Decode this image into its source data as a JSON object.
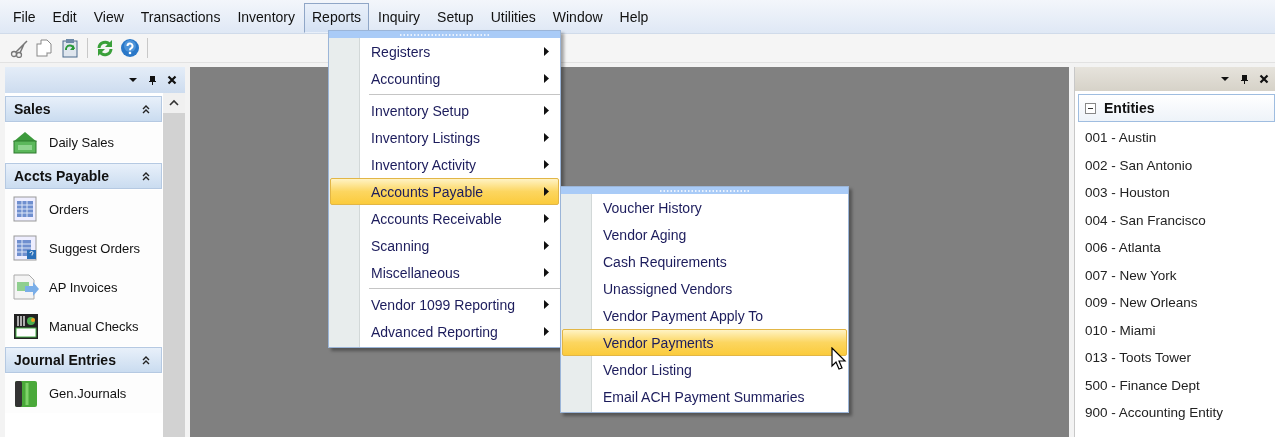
{
  "menubar": {
    "items": [
      {
        "label": "File",
        "selected": false
      },
      {
        "label": "Edit",
        "selected": false
      },
      {
        "label": "View",
        "selected": false
      },
      {
        "label": "Transactions",
        "selected": false
      },
      {
        "label": "Inventory",
        "selected": false
      },
      {
        "label": "Reports",
        "selected": true
      },
      {
        "label": "Inquiry",
        "selected": false
      },
      {
        "label": "Setup",
        "selected": false
      },
      {
        "label": "Utilities",
        "selected": false
      },
      {
        "label": "Window",
        "selected": false
      },
      {
        "label": "Help",
        "selected": false
      }
    ]
  },
  "nav_panel": {
    "groups": [
      {
        "title": "Sales",
        "expanded": true,
        "items": [
          {
            "label": "Daily Sales",
            "kind": "money"
          }
        ]
      },
      {
        "title": "Accts Payable",
        "expanded": true,
        "items": [
          {
            "label": "Orders",
            "kind": "grid"
          },
          {
            "label": "Suggest Orders",
            "kind": "grid-help"
          },
          {
            "label": "AP Invoices",
            "kind": "invoice"
          },
          {
            "label": "Manual Checks",
            "kind": "check"
          }
        ]
      },
      {
        "title": "Journal Entries",
        "expanded": true,
        "items": [
          {
            "label": "Gen.Journals",
            "kind": "book"
          }
        ]
      }
    ]
  },
  "reports_menu": {
    "sections": [
      [
        {
          "label": "Registers",
          "submenu": true,
          "selected": false
        },
        {
          "label": "Accounting",
          "submenu": true,
          "selected": false
        }
      ],
      [
        {
          "label": "Inventory Setup",
          "submenu": true,
          "selected": false
        },
        {
          "label": "Inventory Listings",
          "submenu": true,
          "selected": false
        },
        {
          "label": "Inventory Activity",
          "submenu": true,
          "selected": false
        },
        {
          "label": "Accounts Payable",
          "submenu": true,
          "selected": true
        },
        {
          "label": "Accounts Receivable",
          "submenu": true,
          "selected": false
        },
        {
          "label": "Scanning",
          "submenu": true,
          "selected": false
        },
        {
          "label": "Miscellaneous",
          "submenu": true,
          "selected": false
        }
      ],
      [
        {
          "label": "Vendor 1099 Reporting",
          "submenu": true,
          "selected": false
        },
        {
          "label": "Advanced Reporting",
          "submenu": true,
          "selected": false
        }
      ]
    ]
  },
  "accounts_payable_menu": {
    "sections": [
      [
        {
          "label": "Voucher History",
          "submenu": false,
          "selected": false
        },
        {
          "label": "Vendor Aging",
          "submenu": false,
          "selected": false
        },
        {
          "label": "Cash Requirements",
          "submenu": false,
          "selected": false
        },
        {
          "label": "Unassigned Vendors",
          "submenu": false,
          "selected": false
        },
        {
          "label": "Vendor Payment Apply To",
          "submenu": false,
          "selected": false
        },
        {
          "label": "Vendor Payments",
          "submenu": false,
          "selected": true
        },
        {
          "label": "Vendor Listing",
          "submenu": false,
          "selected": false
        },
        {
          "label": "Email ACH Payment Summaries",
          "submenu": false,
          "selected": false
        }
      ]
    ]
  },
  "entities_panel": {
    "title": "Entities",
    "expanded": true,
    "items": [
      "001 - Austin",
      "002 - San Antonio",
      "003 - Houston",
      "004 - San Francisco",
      "006 - Atlanta",
      "007 - New York",
      "009 - New Orleans",
      "010 - Miami",
      "013 - Toots Tower",
      "500 - Finance Dept",
      "900 - Accounting Entity"
    ]
  }
}
